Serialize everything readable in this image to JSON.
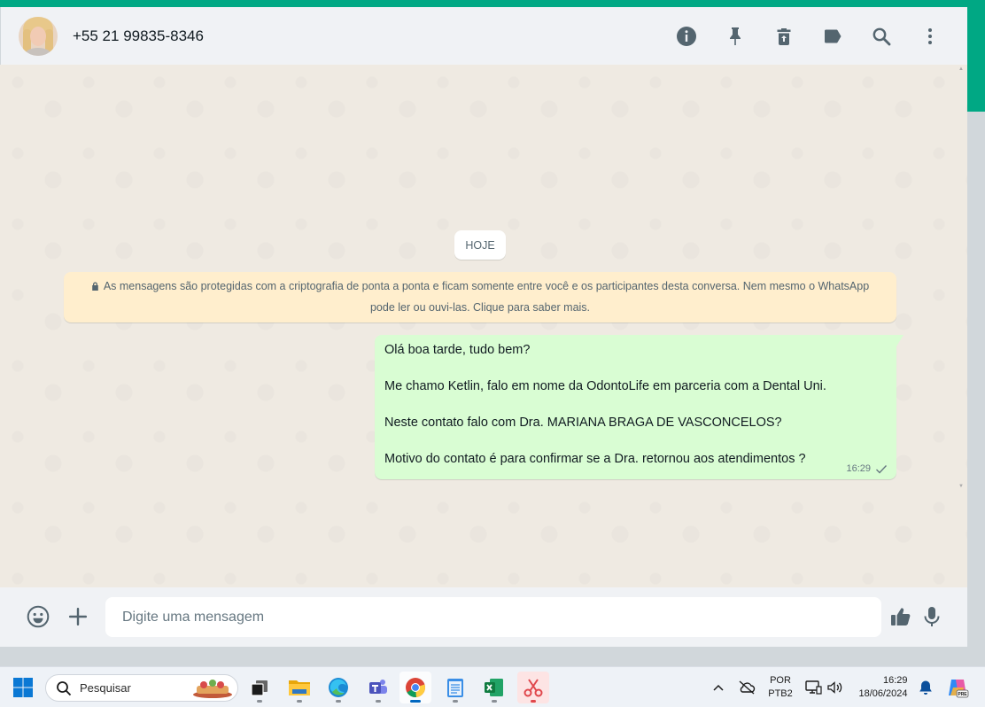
{
  "header": {
    "contact_name": "+55 21 99835-8346",
    "actions": [
      {
        "name": "info-icon",
        "label": "Dados do contato"
      },
      {
        "name": "pin-icon",
        "label": "Fixar"
      },
      {
        "name": "delete-icon",
        "label": "Apagar"
      },
      {
        "name": "label-icon",
        "label": "Etiquetar"
      },
      {
        "name": "search-icon",
        "label": "Pesquisar"
      },
      {
        "name": "more-vertical-icon",
        "label": "Mais opções"
      }
    ]
  },
  "chat": {
    "day_label": "HOJE",
    "encryption_notice": "As mensagens são protegidas com a criptografia de ponta a ponta e ficam somente entre você e os participantes desta conversa. Nem mesmo o WhatsApp pode ler ou ouvi-las. Clique para saber mais.",
    "messages": [
      {
        "direction": "outgoing",
        "lines": [
          "Olá boa tarde, tudo bem?",
          "Me chamo Ketlin, falo em nome da OdontoLife em parceria com a Dental Uni.",
          "Neste contato falo com Dra. MARIANA BRAGA DE VASCONCELOS?",
          "Motivo do contato é para confirmar se a Dra. retornou aos atendimentos ?"
        ],
        "time": "16:29",
        "status": "sent"
      }
    ]
  },
  "composer": {
    "placeholder": "Digite uma mensagem",
    "value": ""
  },
  "taskbar": {
    "search_placeholder": "Pesquisar",
    "apps": [
      "task-view",
      "file-explorer",
      "edge",
      "teams",
      "chrome",
      "notepad",
      "excel",
      "snipping-tool"
    ],
    "active_app": "chrome",
    "language_line1": "POR",
    "language_line2": "PTB2",
    "time": "16:29",
    "date": "18/06/2024"
  },
  "colors": {
    "accent": "#00a884",
    "outgoing_bubble": "#d9fdd3",
    "chat_background": "#efeae2",
    "notice_background": "#ffeecd",
    "header_background": "#f0f2f5"
  }
}
